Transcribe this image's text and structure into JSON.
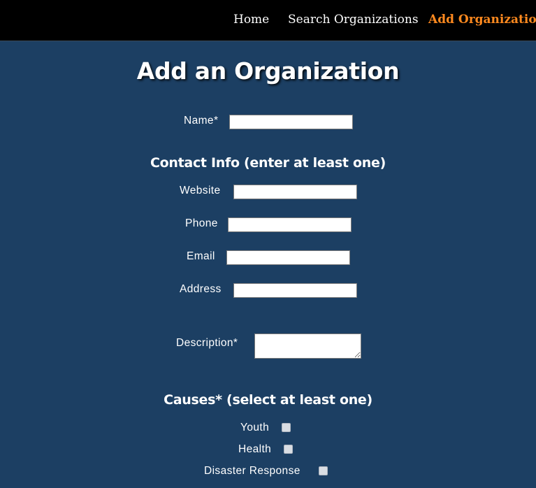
{
  "nav": {
    "home": "Home",
    "search": "Search Organizations",
    "add": "Add Organization",
    "active_color": "#ff8a1f"
  },
  "page": {
    "title": "Add an Organization",
    "background_color": "#1c3f63"
  },
  "form": {
    "name_label": "Name*",
    "contact_heading": "Contact Info (enter at least one)",
    "website_label": "Website",
    "phone_label": "Phone",
    "email_label": "Email",
    "address_label": "Address",
    "description_label": "Description*",
    "causes_heading": "Causes* (select at least one)",
    "causes": [
      {
        "label": "Youth",
        "checked": false
      },
      {
        "label": "Health",
        "checked": false
      },
      {
        "label": "Disaster Response",
        "checked": false
      }
    ]
  }
}
